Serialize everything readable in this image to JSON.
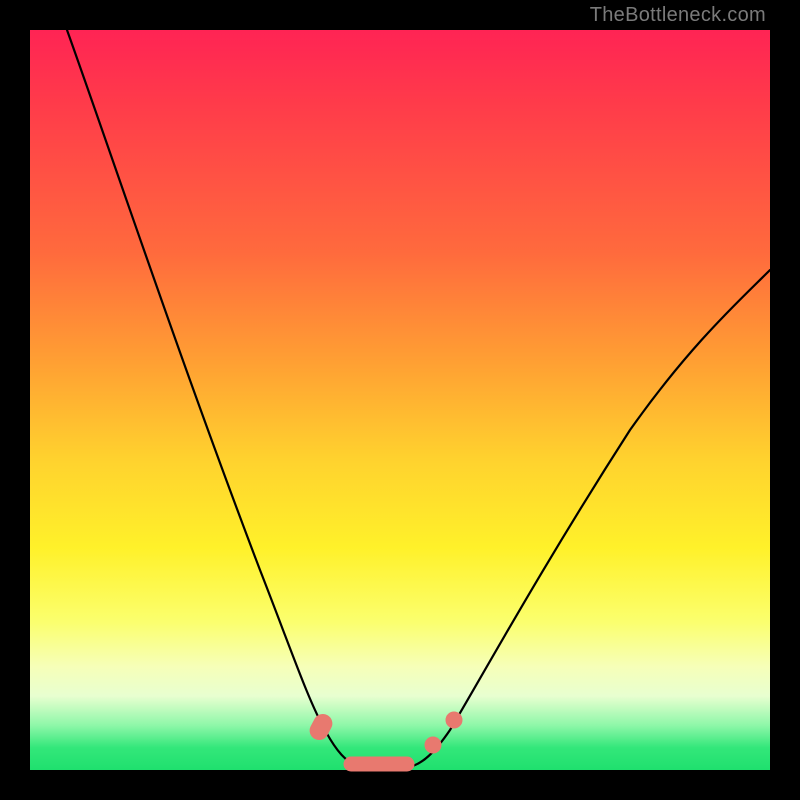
{
  "watermark": "TheBottleneck.com",
  "colors": {
    "frame_bg": "#000000",
    "gradient_top": "#ff2454",
    "gradient_mid1": "#ffa033",
    "gradient_mid2": "#fff12a",
    "gradient_bottom": "#1fe06e",
    "curve": "#000000",
    "markers": "#e8796f"
  },
  "chart_data": {
    "type": "line",
    "title": "",
    "xlabel": "",
    "ylabel": "",
    "xlim": [
      0,
      100
    ],
    "ylim": [
      0,
      100
    ],
    "background": "rainbow-vertical-gradient",
    "series": [
      {
        "name": "bottleneck-curve",
        "x": [
          5,
          10,
          15,
          20,
          25,
          30,
          35,
          38,
          40,
          42,
          45,
          48,
          50,
          52,
          55,
          60,
          65,
          70,
          75,
          80,
          85,
          90,
          95,
          100
        ],
        "y": [
          100,
          88,
          76,
          64,
          52,
          40,
          25,
          12,
          5,
          1,
          0,
          0,
          0,
          1,
          4,
          10,
          18,
          26,
          34,
          42,
          50,
          57,
          63,
          68
        ]
      }
    ],
    "markers": [
      {
        "name": "optimal-zone-pill",
        "x_range": [
          43,
          51
        ],
        "y": 0
      },
      {
        "name": "optimal-point-left",
        "x": 39,
        "y": 6
      },
      {
        "name": "optimal-point-right-a",
        "x": 54,
        "y": 3
      },
      {
        "name": "optimal-point-right-b",
        "x": 57,
        "y": 7
      }
    ],
    "annotations": []
  }
}
